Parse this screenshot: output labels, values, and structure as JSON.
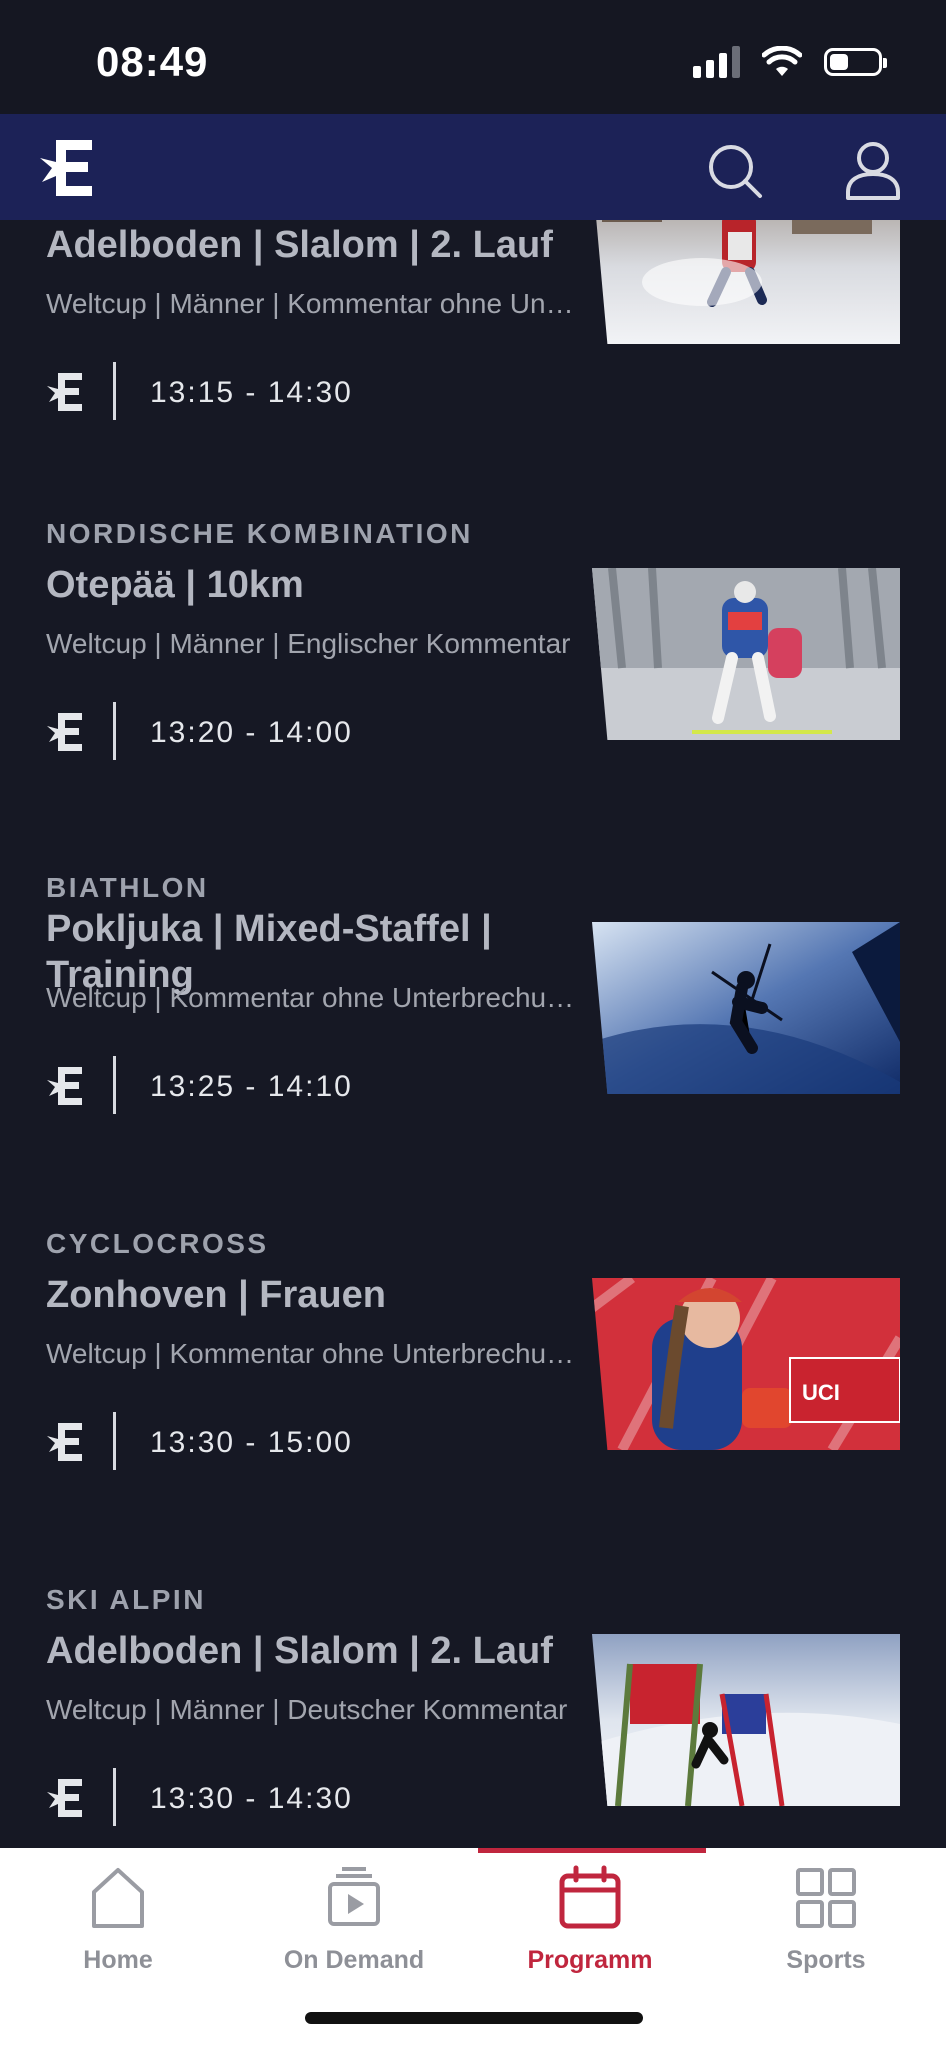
{
  "status_bar": {
    "time": "08:49"
  },
  "header": {
    "logo": "eurosport-logo",
    "search_icon": "search-icon",
    "account_icon": "user-icon"
  },
  "events": [
    {
      "sport": "",
      "title": "Adelboden | Slalom | 2. Lauf",
      "subtitle": "Weltcup | Männer | Kommentar ohne Unterbrechung",
      "time": "13:15 - 14:30"
    },
    {
      "sport": "NORDISCHE KOMBINATION",
      "title": "Otepää | 10km",
      "subtitle": "Weltcup | Männer | Englischer Kommentar",
      "time": "13:20 - 14:00"
    },
    {
      "sport": "BIATHLON",
      "title": "Pokljuka | Mixed-Staffel | Training",
      "subtitle": "Weltcup | Kommentar ohne Unterbrechung",
      "time": "13:25 - 14:10"
    },
    {
      "sport": "CYCLOCROSS",
      "title": "Zonhoven | Frauen",
      "subtitle": "Weltcup | Kommentar ohne Unterbrechung",
      "time": "13:30 - 15:00"
    },
    {
      "sport": "SKI ALPIN",
      "title": "Adelboden | Slalom | 2. Lauf",
      "subtitle": "Weltcup | Männer | Deutscher Kommentar",
      "time": "13:30 - 14:30"
    }
  ],
  "nav": {
    "items": [
      {
        "label": "Home",
        "icon": "home-icon"
      },
      {
        "label": "On Demand",
        "icon": "on-demand-icon"
      },
      {
        "label": "Programm",
        "icon": "calendar-icon"
      },
      {
        "label": "Sports",
        "icon": "grid-icon"
      }
    ],
    "active": "Programm",
    "accent": "#c0263e"
  },
  "colors": {
    "background": "#161824",
    "header": "#1c2257"
  }
}
